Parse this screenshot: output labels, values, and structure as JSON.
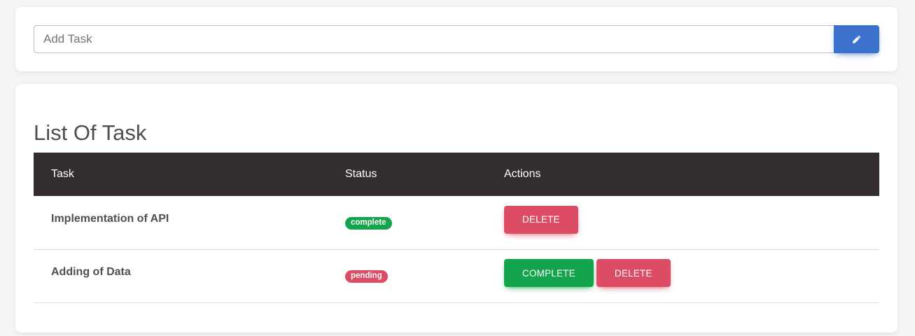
{
  "add_task": {
    "placeholder": "Add Task",
    "value": "",
    "submit_icon": "pencil-icon"
  },
  "list": {
    "title": "List Of Task",
    "headers": {
      "task": "Task",
      "status": "Status",
      "actions": "Actions"
    },
    "rows": [
      {
        "task": "Implementation of API",
        "status": "complete",
        "actions": {
          "delete": "DELETE"
        }
      },
      {
        "task": "Adding of Data",
        "status": "pending",
        "actions": {
          "complete": "COMPLETE",
          "delete": "DELETE"
        }
      }
    ]
  },
  "colors": {
    "primary": "#3b71ca",
    "success": "#14a44d",
    "danger": "#dc4c64",
    "table_header": "#332d2d"
  }
}
